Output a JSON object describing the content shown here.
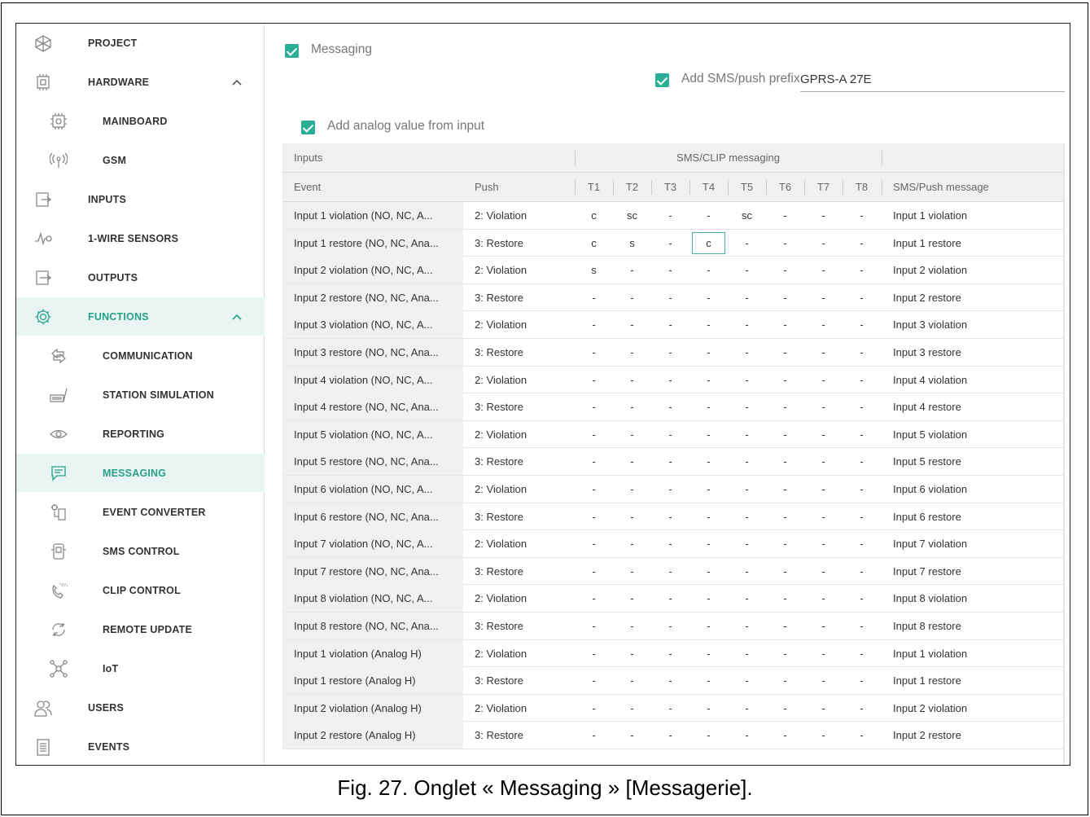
{
  "sidebar": {
    "items": [
      {
        "label": "PROJECT",
        "icon": "project-icon",
        "level": "top",
        "state": ""
      },
      {
        "label": "HARDWARE",
        "icon": "hardware-icon",
        "level": "top",
        "state": "expanded"
      },
      {
        "label": "MAINBOARD",
        "icon": "mainboard-icon",
        "level": "sub",
        "state": ""
      },
      {
        "label": "GSM",
        "icon": "gsm-antenna-icon",
        "level": "sub",
        "state": ""
      },
      {
        "label": "INPUTS",
        "icon": "inputs-icon",
        "level": "top",
        "state": ""
      },
      {
        "label": "1-WIRE SENSORS",
        "icon": "1-wire-sensor-icon",
        "level": "top",
        "state": ""
      },
      {
        "label": "OUTPUTS",
        "icon": "outputs-icon",
        "level": "top",
        "state": ""
      },
      {
        "label": "FUNCTIONS",
        "icon": "gear-icon",
        "level": "top",
        "state": "expanded-active"
      },
      {
        "label": "COMMUNICATION",
        "icon": "communication-icon",
        "level": "sub",
        "state": ""
      },
      {
        "label": "STATION SIMULATION",
        "icon": "station-simulation-icon",
        "level": "sub",
        "state": ""
      },
      {
        "label": "REPORTING",
        "icon": "eye-icon",
        "level": "sub",
        "state": ""
      },
      {
        "label": "MESSAGING",
        "icon": "messaging-icon",
        "level": "sub",
        "state": "selected"
      },
      {
        "label": "EVENT CONVERTER",
        "icon": "event-converter-icon",
        "level": "sub",
        "state": ""
      },
      {
        "label": "SMS CONTROL",
        "icon": "sms-control-icon",
        "level": "sub",
        "state": ""
      },
      {
        "label": "CLIP CONTROL",
        "icon": "clip-control-icon",
        "level": "sub",
        "state": ""
      },
      {
        "label": "REMOTE UPDATE",
        "icon": "remote-update-icon",
        "level": "sub",
        "state": ""
      },
      {
        "label": "IoT",
        "icon": "iot-icon",
        "level": "sub",
        "state": ""
      },
      {
        "label": "USERS",
        "icon": "users-icon",
        "level": "top",
        "state": ""
      },
      {
        "label": "EVENTS",
        "icon": "events-icon",
        "level": "top",
        "state": ""
      }
    ]
  },
  "main": {
    "messaging_label": "Messaging",
    "messaging_checked": true,
    "prefix_label": "Add SMS/push prefix",
    "prefix_checked": true,
    "prefix_value": "GPRS-A 27E",
    "analog_label": "Add analog value from input",
    "analog_checked": true,
    "settings_icon": "table-settings-icon",
    "table": {
      "group_headers": {
        "inputs": "Inputs",
        "sms_clip": "SMS/CLIP messaging",
        "blank": ""
      },
      "columns": {
        "event": "Event",
        "push": "Push",
        "t": [
          "T1",
          "T2",
          "T3",
          "T4",
          "T5",
          "T6",
          "T7",
          "T8"
        ],
        "message": "SMS/Push message"
      },
      "rows": [
        {
          "event": "Input 1 violation (NO, NC, A...",
          "push": "2: Violation",
          "t": [
            "c",
            "sc",
            "-",
            "-",
            "sc",
            "-",
            "-",
            "-"
          ],
          "message": "Input 1 violation"
        },
        {
          "event": "Input 1 restore (NO, NC, Ana...",
          "push": "3: Restore",
          "t": [
            "c",
            "s",
            "-",
            "c",
            "-",
            "-",
            "-",
            "-"
          ],
          "message": "Input 1 restore"
        },
        {
          "event": "Input 2 violation (NO, NC, A...",
          "push": "2: Violation",
          "t": [
            "s",
            "-",
            "-",
            "-",
            "-",
            "-",
            "-",
            "-"
          ],
          "message": "Input 2 violation"
        },
        {
          "event": "Input 2 restore (NO, NC, Ana...",
          "push": "3: Restore",
          "t": [
            "-",
            "-",
            "-",
            "-",
            "-",
            "-",
            "-",
            "-"
          ],
          "message": "Input 2 restore"
        },
        {
          "event": "Input 3 violation (NO, NC, A...",
          "push": "2: Violation",
          "t": [
            "-",
            "-",
            "-",
            "-",
            "-",
            "-",
            "-",
            "-"
          ],
          "message": "Input 3 violation"
        },
        {
          "event": "Input 3 restore (NO, NC, Ana...",
          "push": "3: Restore",
          "t": [
            "-",
            "-",
            "-",
            "-",
            "-",
            "-",
            "-",
            "-"
          ],
          "message": "Input 3 restore"
        },
        {
          "event": "Input 4 violation (NO, NC, A...",
          "push": "2: Violation",
          "t": [
            "-",
            "-",
            "-",
            "-",
            "-",
            "-",
            "-",
            "-"
          ],
          "message": "Input 4 violation"
        },
        {
          "event": "Input 4 restore (NO, NC, Ana...",
          "push": "3: Restore",
          "t": [
            "-",
            "-",
            "-",
            "-",
            "-",
            "-",
            "-",
            "-"
          ],
          "message": "Input 4 restore"
        },
        {
          "event": "Input 5 violation (NO, NC, A...",
          "push": "2: Violation",
          "t": [
            "-",
            "-",
            "-",
            "-",
            "-",
            "-",
            "-",
            "-"
          ],
          "message": "Input 5 violation"
        },
        {
          "event": "Input 5 restore (NO, NC, Ana...",
          "push": "3: Restore",
          "t": [
            "-",
            "-",
            "-",
            "-",
            "-",
            "-",
            "-",
            "-"
          ],
          "message": "Input 5 restore"
        },
        {
          "event": "Input 6 violation (NO, NC, A...",
          "push": "2: Violation",
          "t": [
            "-",
            "-",
            "-",
            "-",
            "-",
            "-",
            "-",
            "-"
          ],
          "message": "Input 6 violation"
        },
        {
          "event": "Input 6 restore (NO, NC, Ana...",
          "push": "3: Restore",
          "t": [
            "-",
            "-",
            "-",
            "-",
            "-",
            "-",
            "-",
            "-"
          ],
          "message": "Input 6 restore"
        },
        {
          "event": "Input 7 violation (NO, NC, A...",
          "push": "2: Violation",
          "t": [
            "-",
            "-",
            "-",
            "-",
            "-",
            "-",
            "-",
            "-"
          ],
          "message": "Input 7 violation"
        },
        {
          "event": "Input 7 restore (NO, NC, Ana...",
          "push": "3: Restore",
          "t": [
            "-",
            "-",
            "-",
            "-",
            "-",
            "-",
            "-",
            "-"
          ],
          "message": "Input 7 restore"
        },
        {
          "event": "Input 8 violation (NO, NC, A...",
          "push": "2: Violation",
          "t": [
            "-",
            "-",
            "-",
            "-",
            "-",
            "-",
            "-",
            "-"
          ],
          "message": "Input 8 violation"
        },
        {
          "event": "Input 8 restore (NO, NC, Ana...",
          "push": "3: Restore",
          "t": [
            "-",
            "-",
            "-",
            "-",
            "-",
            "-",
            "-",
            "-"
          ],
          "message": "Input 8 restore"
        },
        {
          "event": "Input 1 violation (Analog H)",
          "push": "2: Violation",
          "t": [
            "-",
            "-",
            "-",
            "-",
            "-",
            "-",
            "-",
            "-"
          ],
          "message": "Input 1 violation"
        },
        {
          "event": "Input 1 restore (Analog H)",
          "push": "3: Restore",
          "t": [
            "-",
            "-",
            "-",
            "-",
            "-",
            "-",
            "-",
            "-"
          ],
          "message": "Input 1 restore"
        },
        {
          "event": "Input 2 violation (Analog H)",
          "push": "2: Violation",
          "t": [
            "-",
            "-",
            "-",
            "-",
            "-",
            "-",
            "-",
            "-"
          ],
          "message": "Input 2 violation"
        },
        {
          "event": "Input 2 restore (Analog H)",
          "push": "3: Restore",
          "t": [
            "-",
            "-",
            "-",
            "-",
            "-",
            "-",
            "-",
            "-"
          ],
          "message": "Input 2 restore"
        }
      ],
      "focused_cell": {
        "row": 1,
        "col": 3
      }
    }
  },
  "caption": "Fig. 27. Onglet « Messaging » [Messagerie].",
  "colors": {
    "accent": "#2bae96",
    "active_bg": "#e8f5f2",
    "teal_text": "#27a08a"
  }
}
